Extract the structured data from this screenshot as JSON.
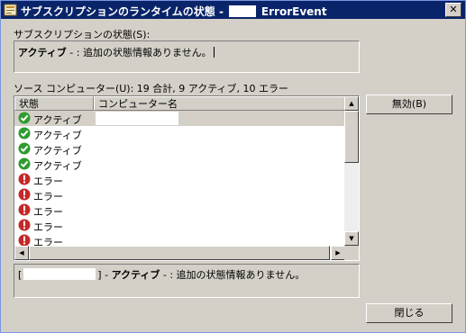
{
  "window": {
    "title_prefix": "サブスクリプションのランタイムの状態 -",
    "title_suffix": "ErrorEvent",
    "close_symbol": "✕"
  },
  "subscription_status": {
    "label": "サブスクリプションの状態(S):",
    "state": "アクティブ",
    "detail": " - : 追加の状態情報ありません。"
  },
  "source_computers": {
    "summary_label": "ソース コンピューター(U): 19 合計, 9 アクティブ, 10 エラー",
    "columns": [
      "状態",
      "コンピューター名"
    ],
    "rows": [
      {
        "status": "アクティブ",
        "kind": "ok"
      },
      {
        "status": "アクティブ",
        "kind": "ok"
      },
      {
        "status": "アクティブ",
        "kind": "ok"
      },
      {
        "status": "アクティブ",
        "kind": "ok"
      },
      {
        "status": "エラー",
        "kind": "error"
      },
      {
        "status": "エラー",
        "kind": "error"
      },
      {
        "status": "エラー",
        "kind": "error"
      },
      {
        "status": "エラー",
        "kind": "error"
      },
      {
        "status": "エラー",
        "kind": "error"
      }
    ]
  },
  "detail_panel": {
    "open_bracket": "[",
    "close_bracket": "] -",
    "state": "アクティブ",
    "detail": " - : 追加の状態情報ありません。"
  },
  "buttons": {
    "disable": "無効(B)",
    "close": "閉じる"
  },
  "colors": {
    "title_bar": "#0a246a",
    "ok_icon": "#2e9b2e",
    "error_icon": "#c62828"
  },
  "icons": {
    "ok": "check-circle-icon",
    "error": "exclamation-circle-icon"
  }
}
